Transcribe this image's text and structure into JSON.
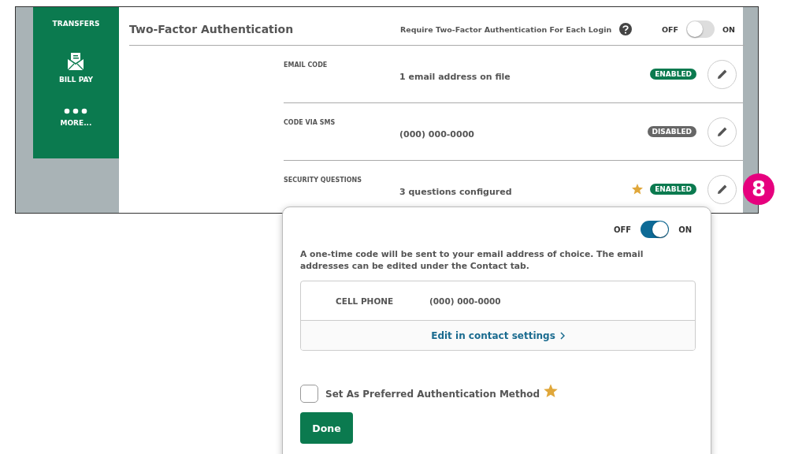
{
  "sidebar": {
    "items": [
      {
        "label": "TRANSFERS",
        "kind": "none"
      },
      {
        "label": "BILL PAY",
        "kind": "bill"
      },
      {
        "label": "MORE...",
        "kind": "more"
      }
    ]
  },
  "header": {
    "title": "Two-Factor Authentication",
    "require_label": "Require Two-Factor Authentication For Each Login",
    "toggle": {
      "off_label": "OFF",
      "on_label": "ON",
      "on": false
    }
  },
  "methods": [
    {
      "label": "EMAIL CODE",
      "value": "1 email address on file",
      "status": "ENABLED",
      "enabled": true,
      "preferred": false
    },
    {
      "label": "CODE VIA SMS",
      "value": "(000) 000-0000",
      "status": "DISABLED",
      "enabled": false,
      "preferred": false
    },
    {
      "label": "SECURITY QUESTIONS",
      "value": "3 questions configured",
      "status": "ENABLED",
      "enabled": true,
      "preferred": true
    }
  ],
  "callout": "8",
  "popup": {
    "toggle": {
      "off_label": "OFF",
      "on_label": "ON",
      "on": true
    },
    "description": "A one-time code will be sent to your email address of choice. The email addresses can be edited under the Contact tab.",
    "contact": {
      "label": "CELL PHONE",
      "value": "(000) 000-0000",
      "link": "Edit in contact settings"
    },
    "preferred_checkbox": {
      "label": "Set As Preferred Authentication Method",
      "checked": false
    },
    "done": "Done"
  }
}
